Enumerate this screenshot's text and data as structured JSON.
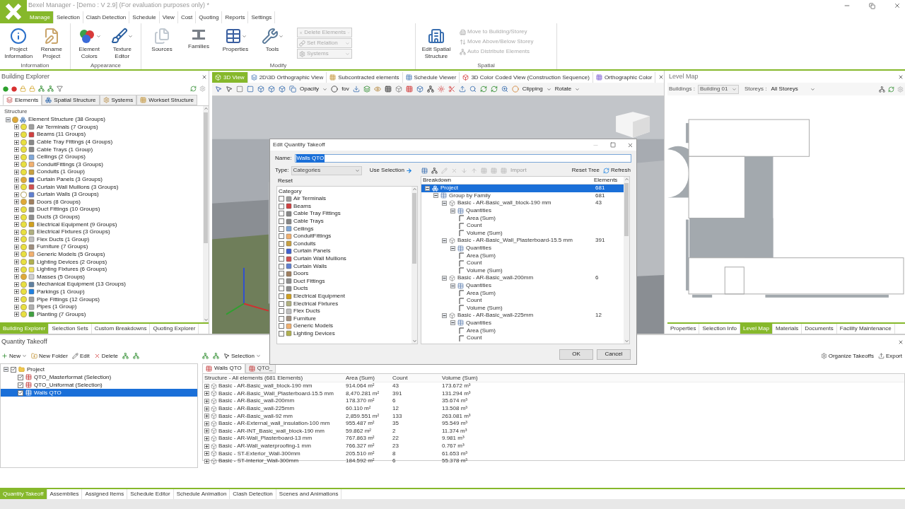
{
  "window": {
    "title": "Bexel Manager - [Demo : V 2.9] (For evaluation purposes only) *"
  },
  "menu_tabs": [
    {
      "label": "Manage",
      "selected": true
    },
    {
      "label": "Selection",
      "selected": false
    },
    {
      "label": "Clash Detection",
      "selected": false
    },
    {
      "label": "Schedule",
      "selected": false
    },
    {
      "label": "View",
      "selected": false
    },
    {
      "label": "Cost",
      "selected": false
    },
    {
      "label": "Quoting",
      "selected": false
    },
    {
      "label": "Reports",
      "selected": false
    },
    {
      "label": "Settings",
      "selected": false
    }
  ],
  "ribbon": [
    {
      "label": "Information",
      "buttons": [
        {
          "kind": "large",
          "label": "Project Information",
          "dropdown": false
        },
        {
          "kind": "large",
          "label": "Rename Project",
          "dropdown": false
        }
      ]
    },
    {
      "label": "Appearance",
      "buttons": [
        {
          "kind": "large",
          "label": "Element Colors",
          "dropdown": true
        },
        {
          "kind": "large",
          "label": "Texture Editor",
          "dropdown": true
        }
      ]
    },
    {
      "label": "Modify",
      "buttons": [
        {
          "kind": "large",
          "label": "Sources",
          "dropdown": false
        },
        {
          "kind": "large",
          "label": "Families",
          "dropdown": false
        },
        {
          "kind": "large",
          "label": "Properties",
          "dropdown": true
        },
        {
          "kind": "large",
          "label": "Tools",
          "dropdown": true
        },
        {
          "kind": "small",
          "label": "Delete Elements",
          "disabled": true
        },
        {
          "kind": "small",
          "label": "Set Relation",
          "disabled": true
        },
        {
          "kind": "small",
          "label": "Systems",
          "disabled": true
        }
      ]
    },
    {
      "label": "Spatial",
      "buttons": [
        {
          "kind": "large",
          "label": "Edit Spatial Structure",
          "dropdown": false
        },
        {
          "kind": "link",
          "label": "Move to Building/Storey",
          "disabled": true
        },
        {
          "kind": "link",
          "label": "Move Above/Below Storey",
          "disabled": true
        },
        {
          "kind": "link",
          "label": "Auto Distribute Elements",
          "disabled": true
        }
      ]
    }
  ],
  "building_explorer": {
    "title": "Building Explorer",
    "tabs": [
      {
        "label": "Elements",
        "selected": true
      },
      {
        "label": "Spatial Structure",
        "selected": false
      },
      {
        "label": "Systems",
        "selected": false
      },
      {
        "label": "Workset Structure",
        "selected": false
      }
    ],
    "tree_header": "Structure",
    "root": {
      "label": "Element Structure (38 Groups)",
      "color": "#e0a838",
      "expanded": true,
      "children": [
        {
          "label": "Air Terminals (7 Groups)",
          "color": "#e8e040",
          "expanded": false
        },
        {
          "label": "Beams (11 Groups)",
          "color": "#e8e040",
          "expanded": false
        },
        {
          "label": "Cable Tray Fittings (4 Groups)",
          "color": "#e8e040",
          "expanded": false
        },
        {
          "label": "Cable Trays (1 Group)",
          "color": "#e8e040",
          "expanded": false
        },
        {
          "label": "Ceilings (2 Groups)",
          "color": "#e8e040",
          "expanded": false
        },
        {
          "label": "ConduitFittings (3 Groups)",
          "color": "#e8e040",
          "expanded": false
        },
        {
          "label": "Conduits (1 Group)",
          "color": "#e8e040",
          "expanded": false
        },
        {
          "label": "Curtain Panels (3 Groups)",
          "color": "#e0a838",
          "expanded": false
        },
        {
          "label": "Curtain Wall Mullions (3 Groups)",
          "color": "#e8e040",
          "expanded": false
        },
        {
          "label": "Curtain Walls (3 Groups)",
          "color": "#ffffff",
          "expanded": false
        },
        {
          "label": "Doors (8 Groups)",
          "color": "#e0a838",
          "expanded": false
        },
        {
          "label": "Duct Fittings (10 Groups)",
          "color": "#e8e040",
          "expanded": false
        },
        {
          "label": "Ducts (3 Groups)",
          "color": "#e8e040",
          "expanded": false
        },
        {
          "label": "Electrical Equipment (9 Groups)",
          "color": "#e8e040",
          "expanded": false
        },
        {
          "label": "Electrical Fixtures (3 Groups)",
          "color": "#e8e040",
          "expanded": false
        },
        {
          "label": "Flex Ducts (1 Group)",
          "color": "#e8e040",
          "expanded": false
        },
        {
          "label": "Furniture (7 Groups)",
          "color": "#e8e040",
          "expanded": false
        },
        {
          "label": "Generic Models (5 Groups)",
          "color": "#e8e040",
          "expanded": false
        },
        {
          "label": "Lighting Devices (2 Groups)",
          "color": "#e8e040",
          "expanded": false
        },
        {
          "label": "Lighting Fixtures (6 Groups)",
          "color": "#e8e040",
          "expanded": false
        },
        {
          "label": "Masses (5 Groups)",
          "color": "#e0a838",
          "expanded": false
        },
        {
          "label": "Mechanical Equipment (13 Groups)",
          "color": "#e8e040",
          "expanded": false
        },
        {
          "label": "Parkings (1 Group)",
          "color": "#e8e040",
          "expanded": false
        },
        {
          "label": "Pipe Fittings (12 Groups)",
          "color": "#e8e040",
          "expanded": false
        },
        {
          "label": "Pipes (1 Group)",
          "color": "#e8e040",
          "expanded": false
        },
        {
          "label": "Planting (7 Groups)",
          "color": "#e8e040",
          "expanded": false
        }
      ]
    },
    "bottom_tabs": [
      {
        "label": "Building Explorer",
        "selected": true
      },
      {
        "label": "Selection Sets",
        "selected": false
      },
      {
        "label": "Custom Breakdowns",
        "selected": false
      },
      {
        "label": "Quoting Explorer",
        "selected": false
      }
    ]
  },
  "view": {
    "tabs": [
      {
        "label": "3D View",
        "selected": true
      },
      {
        "label": "2D\\3D Orthographic View",
        "selected": false
      },
      {
        "label": "Subcontracted elements",
        "selected": false
      },
      {
        "label": "Schedule Viewer",
        "selected": false
      },
      {
        "label": "3D Color Coded View (Construction Sequence)",
        "selected": false
      },
      {
        "label": "Orthographic Color",
        "selected": false
      }
    ],
    "toolbar": [
      "Opacity",
      "fov",
      "Clipping",
      "Rotate"
    ]
  },
  "level_map": {
    "title": "Level Map",
    "buildings_label": "Buildings :",
    "building": "Building 01",
    "storeys_label": "Storeys :",
    "storey": "All Storeys",
    "bottom_tabs": [
      {
        "label": "Properties",
        "selected": false
      },
      {
        "label": "Selection Info",
        "selected": false
      },
      {
        "label": "Level Map",
        "selected": true
      },
      {
        "label": "Materials",
        "selected": false
      },
      {
        "label": "Documents",
        "selected": false
      },
      {
        "label": "Facility Maintenance",
        "selected": false
      }
    ]
  },
  "dialog": {
    "title": "Edit Quantity Takeoff",
    "name_label": "Name:",
    "name_value": "Walls QTO",
    "type_label": "Type:",
    "type_value": "Categories",
    "use_selection": "Use Selection",
    "import": "Import",
    "reset_tree": "Reset Tree",
    "refresh": "Refresh",
    "reset": "Reset",
    "category_header": "Category",
    "categories": [
      {
        "label": "Air Terminals",
        "checked": false
      },
      {
        "label": "Beams",
        "checked": false
      },
      {
        "label": "Cable Tray Fittings",
        "checked": false
      },
      {
        "label": "Cable Trays",
        "checked": false
      },
      {
        "label": "Ceilings",
        "checked": false
      },
      {
        "label": "ConduitFittings",
        "checked": false
      },
      {
        "label": "Conduits",
        "checked": false
      },
      {
        "label": "Curtain Panels",
        "checked": false
      },
      {
        "label": "Curtain Wall Mullions",
        "checked": false
      },
      {
        "label": "Curtain Walls",
        "checked": false
      },
      {
        "label": "Doors",
        "checked": false
      },
      {
        "label": "Duct Fittings",
        "checked": false
      },
      {
        "label": "Ducts",
        "checked": false
      },
      {
        "label": "Electrical Equipment",
        "checked": false
      },
      {
        "label": "Electrical Fixtures",
        "checked": false
      },
      {
        "label": "Flex Ducts",
        "checked": false
      },
      {
        "label": "Furniture",
        "checked": false
      },
      {
        "label": "Generic Models",
        "checked": false
      },
      {
        "label": "Lighting Devices",
        "checked": false
      }
    ],
    "breakdown_header": "Breakdown",
    "elements_header": "Elements",
    "tree": [
      {
        "kind": "root",
        "label": "Project",
        "elements": "681",
        "selected": true,
        "expanded": true,
        "children": [
          {
            "kind": "group",
            "label": "Group by Family",
            "elements": "681",
            "selected": false,
            "expanded": true,
            "children": [
              {
                "kind": "family",
                "label": "Basic - AR-Basic_wall_block-190 mm",
                "elements": "43",
                "selected": false,
                "expanded": true,
                "children": [
                  {
                    "kind": "quantities",
                    "label": "Quantities",
                    "selected": false,
                    "expanded": true,
                    "children": [
                      {
                        "kind": "quantity",
                        "label": "Area (Sum)",
                        "selected": false
                      },
                      {
                        "kind": "quantity",
                        "label": "Count",
                        "selected": false
                      },
                      {
                        "kind": "quantity",
                        "label": "Volume (Sum)",
                        "selected": false
                      }
                    ]
                  }
                ]
              },
              {
                "kind": "family",
                "label": "Basic - AR-Basic_Wall_Plasterboard-15.5 mm",
                "elements": "391",
                "selected": false,
                "expanded": true,
                "children": [
                  {
                    "kind": "quantities",
                    "label": "Quantities",
                    "selected": false,
                    "expanded": true,
                    "children": [
                      {
                        "kind": "quantity",
                        "label": "Area (Sum)",
                        "selected": false
                      },
                      {
                        "kind": "quantity",
                        "label": "Count",
                        "selected": false
                      },
                      {
                        "kind": "quantity",
                        "label": "Volume (Sum)",
                        "selected": false
                      }
                    ]
                  }
                ]
              },
              {
                "kind": "family",
                "label": "Basic - AR-Basic_wall-200mm",
                "elements": "6",
                "selected": false,
                "expanded": true,
                "children": [
                  {
                    "kind": "quantities",
                    "label": "Quantities",
                    "selected": false,
                    "expanded": true,
                    "children": [
                      {
                        "kind": "quantity",
                        "label": "Area (Sum)",
                        "selected": false
                      },
                      {
                        "kind": "quantity",
                        "label": "Count",
                        "selected": false
                      },
                      {
                        "kind": "quantity",
                        "label": "Volume (Sum)",
                        "selected": false
                      }
                    ]
                  }
                ]
              },
              {
                "kind": "family",
                "label": "Basic - AR-Basic_wall-225mm",
                "elements": "12",
                "selected": false,
                "expanded": true,
                "children": [
                  {
                    "kind": "quantities",
                    "label": "Quantities",
                    "selected": false,
                    "expanded": true,
                    "children": [
                      {
                        "kind": "quantity",
                        "label": "Area (Sum)",
                        "selected": false
                      },
                      {
                        "kind": "quantity",
                        "label": "Count",
                        "selected": false
                      }
                    ]
                  }
                ]
              }
            ]
          }
        ]
      }
    ],
    "buttons": [
      "OK",
      "Cancel"
    ]
  },
  "quantity_takeoff": {
    "title": "Quantity Takeoff",
    "toolbar": [
      "New",
      "New Folder",
      "Edit",
      "Delete"
    ],
    "selection": "Selection",
    "organize": "Organize Takeoffs",
    "export": "Export",
    "tree": {
      "label": "Project",
      "checked": true,
      "expanded": true,
      "children": [
        {
          "label": "QTO_Masterformat (Selection)",
          "checked": true,
          "selected": false
        },
        {
          "label": "QTO_Uniformat (Selection)",
          "checked": true,
          "selected": false
        },
        {
          "label": "Walls QTO",
          "checked": true,
          "selected": true
        }
      ]
    },
    "tabs": [
      {
        "label": "Walls QTO",
        "selected": true
      },
      {
        "label": "QTO_",
        "selected": false
      }
    ],
    "table": {
      "columns": [
        "Structure - All elements (681 Elements)",
        "Area (Sum)",
        "Count",
        "Volume (Sum)"
      ],
      "rows": [
        [
          "Basic - AR-Basic_wall_block-190 mm",
          "914.064 m²",
          "43",
          "173.672 m³"
        ],
        [
          "Basic - AR-Basic_Wall_Plasterboard-15.5 mm",
          "8,470.281 m²",
          "391",
          "131.294 m³"
        ],
        [
          "Basic - AR-Basic_wall-200mm",
          "178.370 m²",
          "6",
          "35.674 m³"
        ],
        [
          "Basic - AR-Basic_wall-225mm",
          "60.110 m²",
          "12",
          "13.508 m³"
        ],
        [
          "Basic - AR-Basic_wall-92 mm",
          "2,859.551 m²",
          "133",
          "263.081 m³"
        ],
        [
          "Basic - AR-External_wall_insulation-100 mm",
          "955.487 m²",
          "35",
          "95.549 m³"
        ],
        [
          "Basic - AR-INT_Basic_wall_block-190 mm",
          "59.862 m²",
          "2",
          "11.374 m³"
        ],
        [
          "Basic - AR-Wall_Plasterboard-13 mm",
          "767.863 m²",
          "22",
          "9.981 m³"
        ],
        [
          "Basic - AR-Wall_waterproofing-1 mm",
          "766.327 m²",
          "23",
          "0.767 m³"
        ],
        [
          "Basic - ST-Exterior_Wall-300mm",
          "205.510 m²",
          "8",
          "61.653 m³"
        ],
        [
          "Basic - ST-Interior_Wall-300mm",
          "184.592 m²",
          "6",
          "55.378 m³"
        ]
      ]
    },
    "bottom_tabs": [
      {
        "label": "Quantity Takeoff",
        "selected": true
      },
      {
        "label": "Assemblies",
        "selected": false
      },
      {
        "label": "Assigned Items",
        "selected": false
      },
      {
        "label": "Schedule Editor",
        "selected": false
      },
      {
        "label": "Schedule Animation",
        "selected": false
      },
      {
        "label": "Clash Detection",
        "selected": false
      },
      {
        "label": "Scenes and Animations",
        "selected": false
      }
    ]
  }
}
